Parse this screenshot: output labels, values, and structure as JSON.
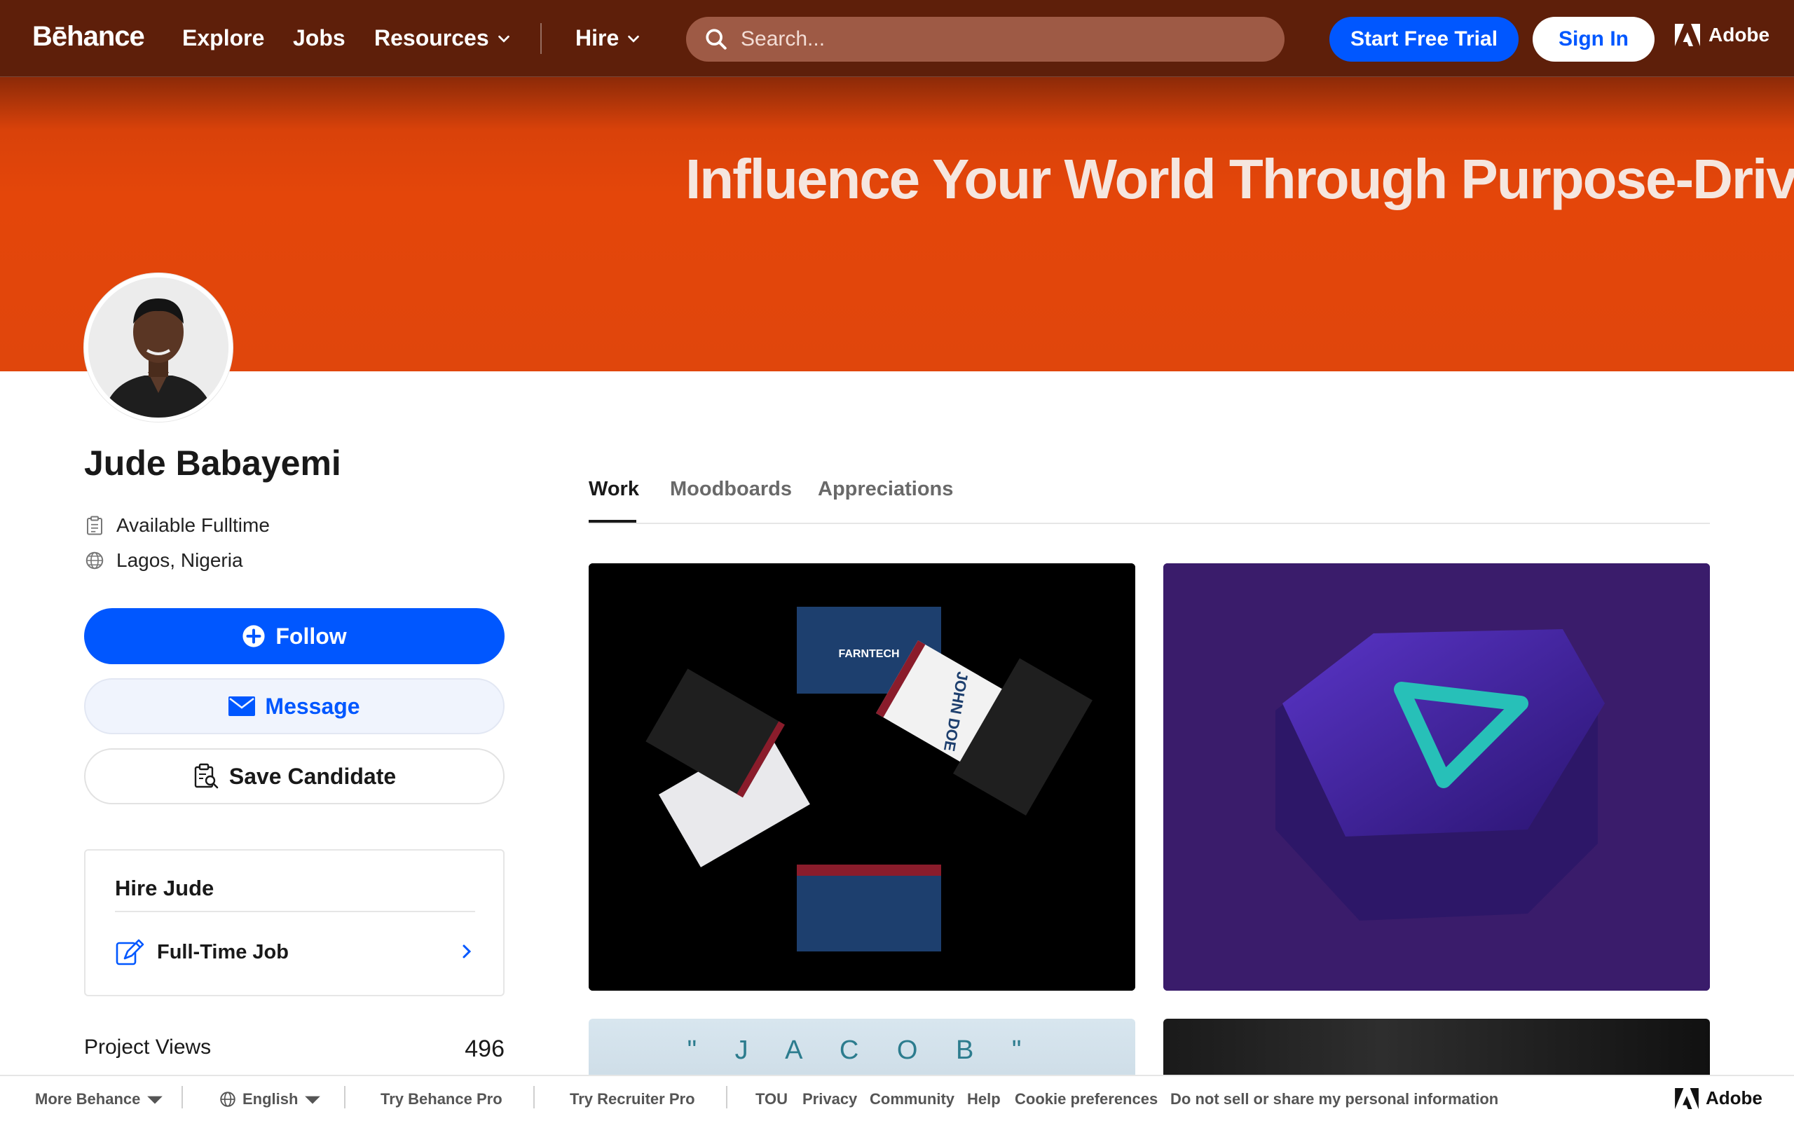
{
  "header": {
    "logo": "Bēhance",
    "nav": [
      "Explore",
      "Jobs",
      "Resources",
      "Hire"
    ],
    "search_placeholder": "Search...",
    "start_trial": "Start Free Trial",
    "sign_in": "Sign In",
    "adobe": "Adobe"
  },
  "banner": {
    "headline": "Influence Your World Through Purpose-Driven"
  },
  "profile": {
    "name": "Jude Babayemi",
    "availability": "Available Fulltime",
    "location": "Lagos, Nigeria",
    "follow": "Follow",
    "message": "Message",
    "save_candidate": "Save Candidate",
    "hire_title": "Hire Jude",
    "hire_option": "Full-Time Job",
    "views_label": "Project Views",
    "views_value": "496"
  },
  "tabs": [
    "Work",
    "Moodboards",
    "Appreciations"
  ],
  "projects": {
    "card1_brand": "FARNTECH",
    "card1_name": "JOHN DOE",
    "card3_title": "\" J A C O B \""
  },
  "footer": {
    "more": "More Behance",
    "language": "English",
    "pro": "Try Behance Pro",
    "recruiter": "Try Recruiter Pro",
    "links": [
      "TOU",
      "Privacy",
      "Community",
      "Help",
      "Cookie preferences",
      "Do not sell or share my personal information"
    ],
    "adobe": "Adobe"
  },
  "colors": {
    "brand_blue": "#0057ff",
    "banner_orange": "#e4460a",
    "header_bg": "#5e1f0a"
  }
}
